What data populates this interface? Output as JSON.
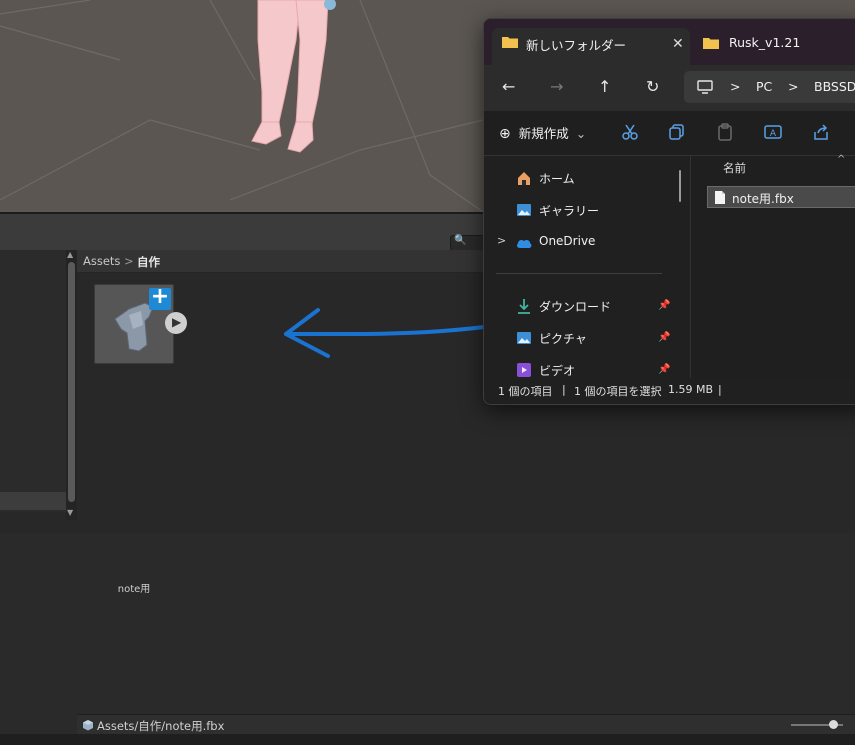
{
  "unity": {
    "breadcrumb": {
      "root": "Assets",
      "separator": ">",
      "current": "自作"
    },
    "asset": {
      "label": "note用",
      "badge_add": "+",
      "badge_play": "▶"
    },
    "status_path": "Assets/自作/note用.fbx",
    "search_icon": "🔍",
    "scroll_up": "▲",
    "scroll_down": "▼"
  },
  "explorer": {
    "tabs": [
      {
        "label": "新しいフォルダー",
        "close": "✕",
        "icon": "folder-icon"
      },
      {
        "label": "Rusk_v1.21",
        "icon": "folder-icon"
      }
    ],
    "nav_buttons": {
      "back": "←",
      "forward": "→",
      "up": "↑",
      "refresh": "↻"
    },
    "address": {
      "pc": "PC",
      "sep": ">",
      "drive": "BBSSD"
    },
    "toolbar": {
      "new_label": "新規作成",
      "new_plus": "⊕",
      "chevron": "⌄"
    },
    "nav_items": [
      {
        "label": "ホーム",
        "icon": "home-icon"
      },
      {
        "label": "ギャラリー",
        "icon": "gallery-icon"
      },
      {
        "label": "OneDrive",
        "icon": "cloud-icon",
        "expander": ">"
      },
      {
        "label": "ダウンロード",
        "icon": "download-icon",
        "pinned": true
      },
      {
        "label": "ピクチャ",
        "icon": "pictures-icon",
        "pinned": true
      },
      {
        "label": "ビデオ",
        "icon": "video-icon",
        "pinned": true
      }
    ],
    "pin_glyph": "📌",
    "column_header": "名前",
    "sort_glyph": "^",
    "file": {
      "name": "note用.fbx"
    },
    "status": {
      "items": "1 個の項目",
      "selected": "1 個の項目を選択",
      "size": "1.59 MB",
      "sep": "|"
    }
  },
  "annotation_color": "#1a73d0"
}
